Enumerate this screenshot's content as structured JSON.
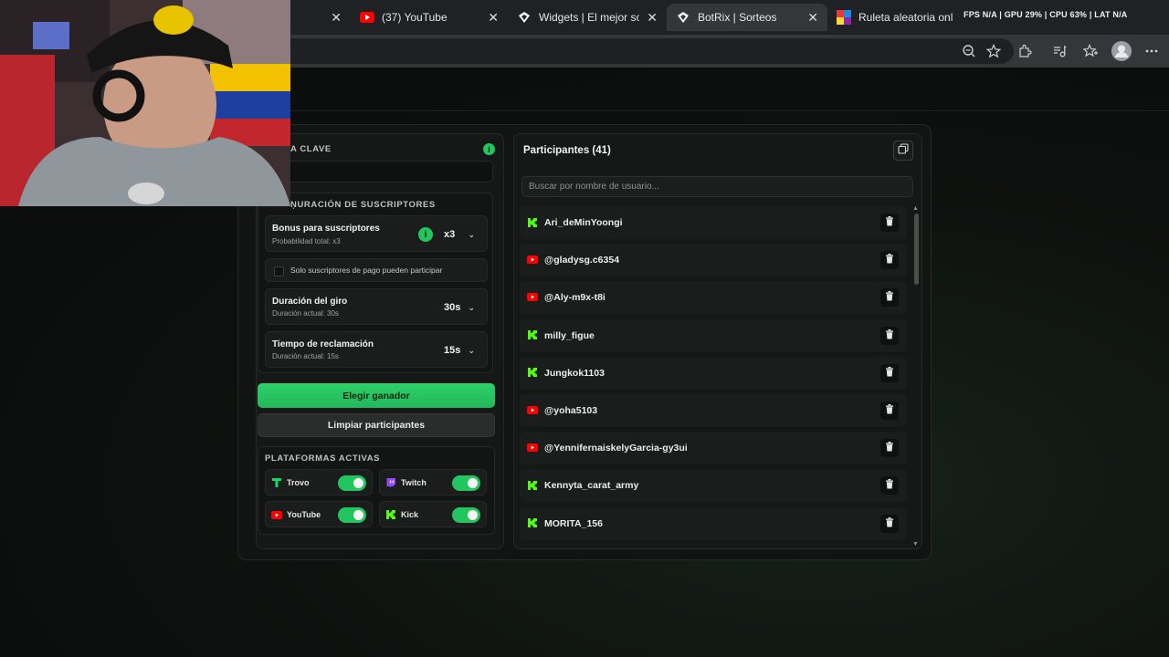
{
  "browser": {
    "tabs": [
      {
        "title": "",
        "icon": "blank-icon",
        "active": false
      },
      {
        "title": "(37) YouTube",
        "icon": "youtube-icon",
        "active": false
      },
      {
        "title": "Widgets | El mejor softw",
        "icon": "botrix-icon",
        "active": false
      },
      {
        "title": "BotRix | Sorteos",
        "icon": "botrix-icon",
        "active": true
      },
      {
        "title": "Ruleta aleatoria online",
        "icon": "wheel-icon",
        "active": false
      }
    ],
    "hud_text": "FPS N/A | GPU 29% | CPU 63% | LAT N/A"
  },
  "keyword": {
    "label": "A CLAVE",
    "value": ""
  },
  "subscriber_config": {
    "label": "ŅURACIÓN DE SUSCRIPTORES",
    "bonus": {
      "title": "Bonus para suscriptores",
      "subtitle": "Probabilidad total: x3",
      "value": "x3"
    },
    "paid_only": {
      "label": "Solo suscriptores de pago pueden participar",
      "checked": false
    },
    "spin_duration": {
      "title": "Duración del giro",
      "subtitle": "Duración actual: 30s",
      "value": "30s"
    },
    "claim_time": {
      "title": "Tiempo de reclamación",
      "subtitle": "Duración actual: 15s",
      "value": "15s"
    }
  },
  "actions": {
    "pick_winner": "Elegir ganador",
    "clear_participants": "Limpiar participantes"
  },
  "platforms": {
    "label": "PLATAFORMAS ACTIVAS",
    "items": [
      {
        "name": "Trovo",
        "icon": "trovo-icon",
        "enabled": true
      },
      {
        "name": "Twitch",
        "icon": "twitch-icon",
        "enabled": true
      },
      {
        "name": "YouTube",
        "icon": "youtube-icon",
        "enabled": true
      },
      {
        "name": "Kick",
        "icon": "kick-icon",
        "enabled": true
      }
    ]
  },
  "participants_panel": {
    "title": "Participantes (41)",
    "search_placeholder": "Buscar por nombre de usuario...",
    "list": [
      {
        "name": "Ari_deMinYoongi",
        "platform": "kick"
      },
      {
        "name": "@gladysg.c6354",
        "platform": "youtube"
      },
      {
        "name": "@Aly-m9x-t8i",
        "platform": "youtube"
      },
      {
        "name": "milly_figue",
        "platform": "kick"
      },
      {
        "name": "Jungkok1103",
        "platform": "kick"
      },
      {
        "name": "@yoha5103",
        "platform": "youtube"
      },
      {
        "name": "@YennifernaiskelyGarcia-gy3ui",
        "platform": "youtube"
      },
      {
        "name": "Kennyta_carat_army",
        "platform": "kick"
      },
      {
        "name": "MORITA_156",
        "platform": "kick"
      }
    ]
  },
  "colors": {
    "accent_green": "#22c55e",
    "kick_green": "#53fc18",
    "youtube_red": "#ff0000",
    "twitch_purple": "#9146ff",
    "trovo_green": "#19d66b"
  }
}
